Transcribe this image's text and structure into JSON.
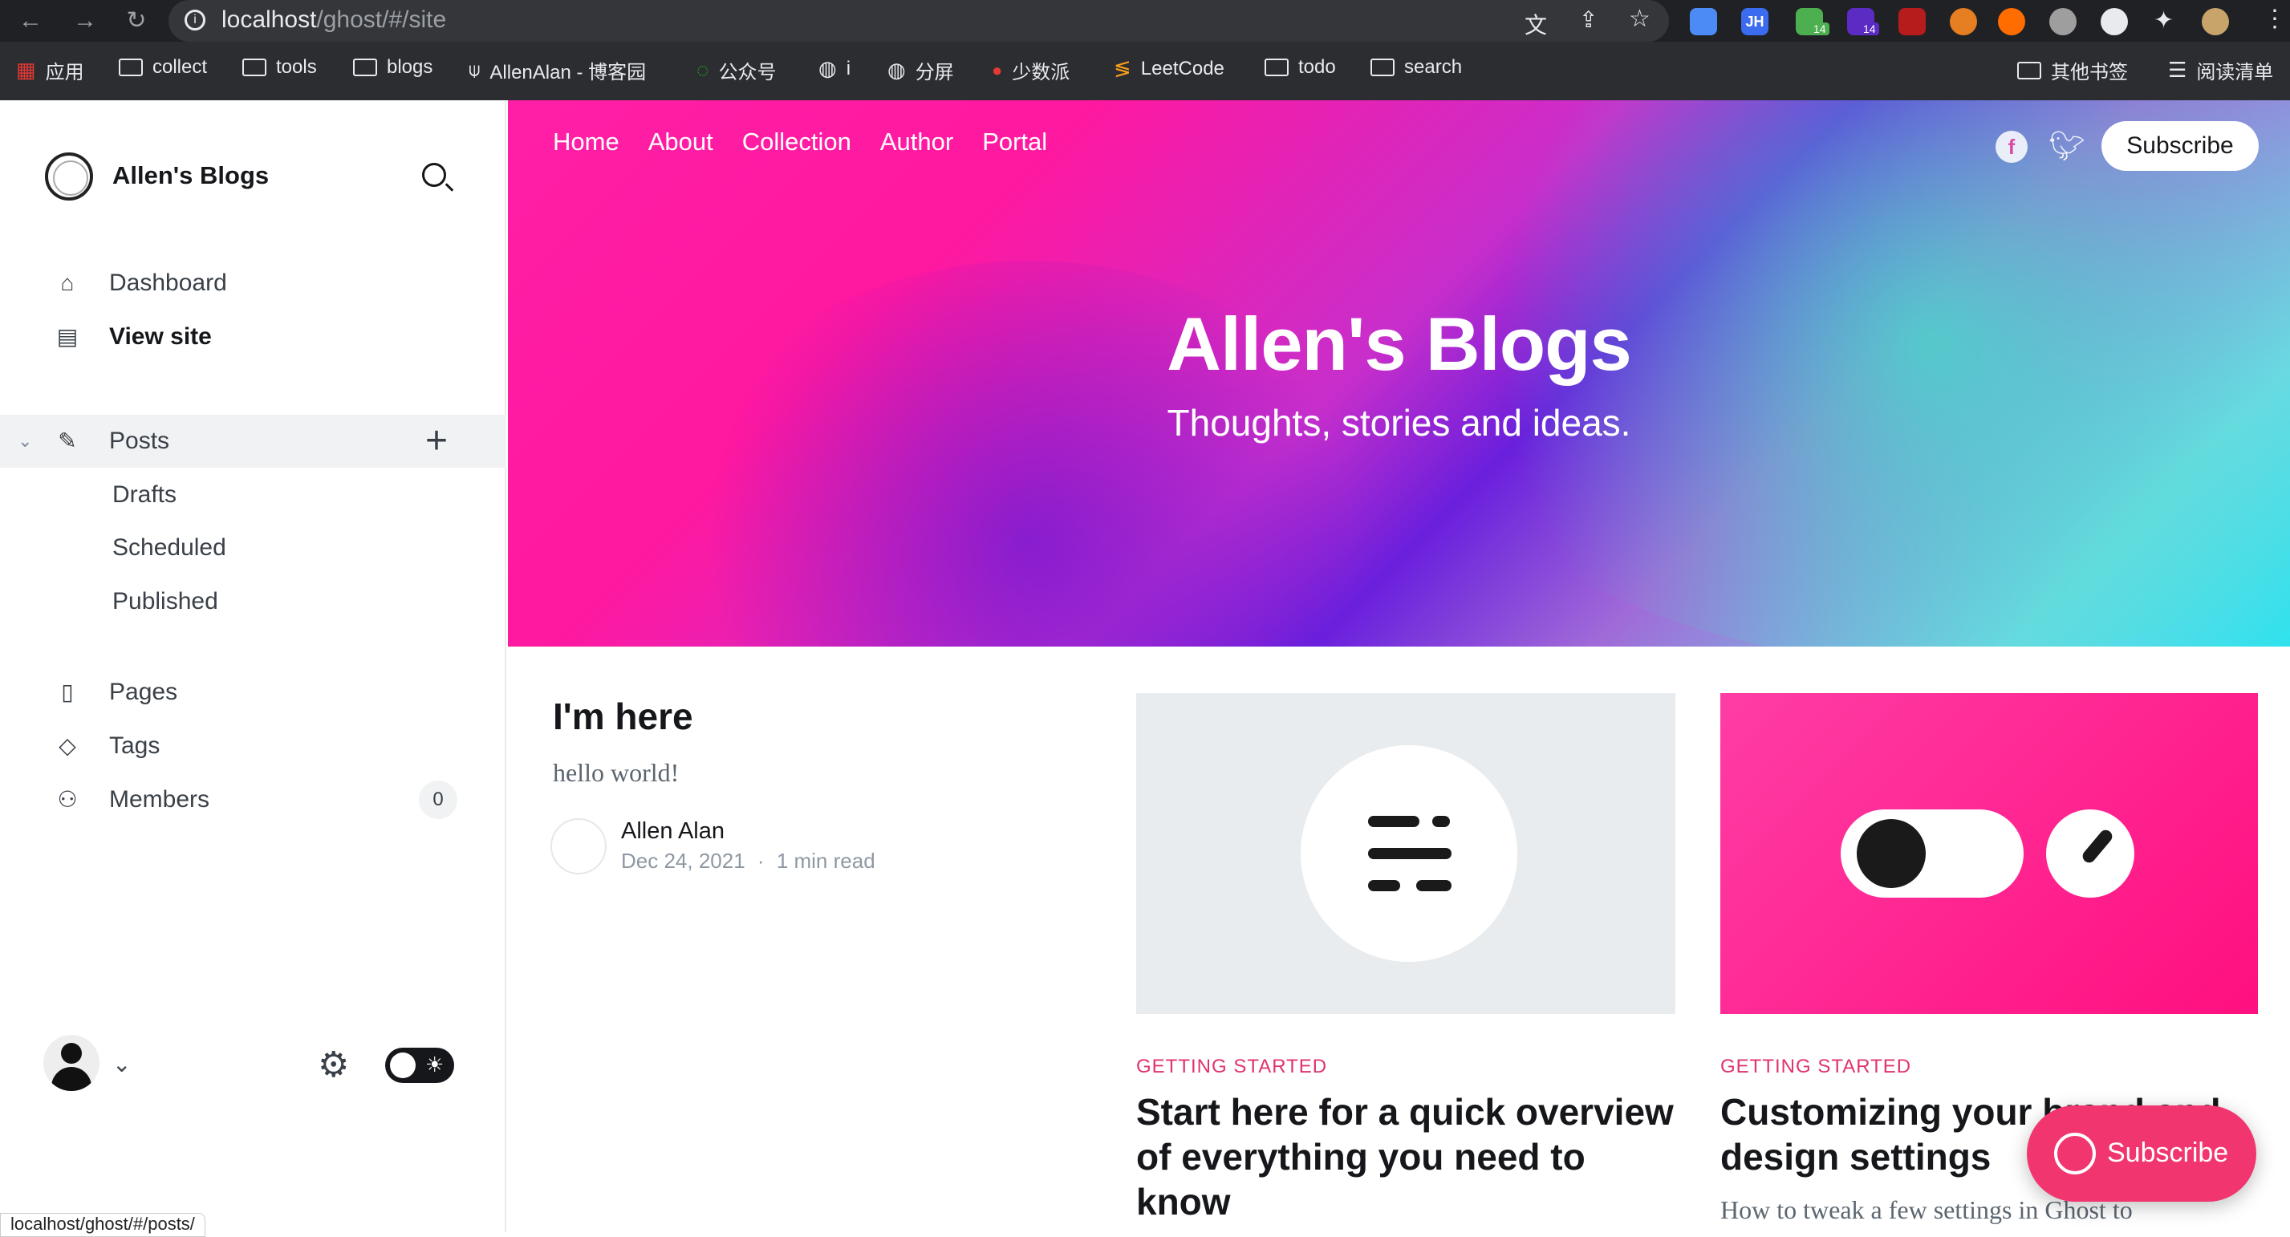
{
  "browser": {
    "url_host": "localhost",
    "url_path": "/ghost/#/site",
    "bookmarks": [
      "应用",
      "collect",
      "tools",
      "blogs",
      "AllenAlan - 博客园",
      "公众号",
      "i",
      "分屏",
      "少数派",
      "LeetCode",
      "todo",
      "search"
    ],
    "bookmarks_right": [
      "其他书签",
      "阅读清单"
    ],
    "status_url": "localhost/ghost/#/posts/",
    "ext_badge_count": "14"
  },
  "sidebar": {
    "brand": "Allen's Blogs",
    "nav": [
      "Dashboard",
      "View site"
    ],
    "posts_label": "Posts",
    "post_subs": [
      "Drafts",
      "Scheduled",
      "Published"
    ],
    "nav2": [
      "Pages",
      "Tags",
      "Members"
    ],
    "members_count": "0"
  },
  "site": {
    "nav": [
      "Home",
      "About",
      "Collection",
      "Author",
      "Portal"
    ],
    "subscribe": "Subscribe",
    "title": "Allen's Blogs",
    "description": "Thoughts, stories and ideas."
  },
  "posts": [
    {
      "title": "I'm here",
      "excerpt": "hello world!",
      "author": "Allen Alan",
      "date": "Dec 24, 2021",
      "read_time": "1 min read"
    },
    {
      "tag": "GETTING STARTED",
      "title": "Start here for a quick overview of everything you need to know"
    },
    {
      "tag": "GETTING STARTED",
      "title": "Customizing your brand and design settings",
      "excerpt": "How to tweak a few settings in Ghost to"
    }
  ],
  "portal_button": "Subscribe",
  "colors": {
    "accent": "#e0336f",
    "hero_pink": "#ff1fa6",
    "hero_cyan": "#2fe2ec"
  }
}
